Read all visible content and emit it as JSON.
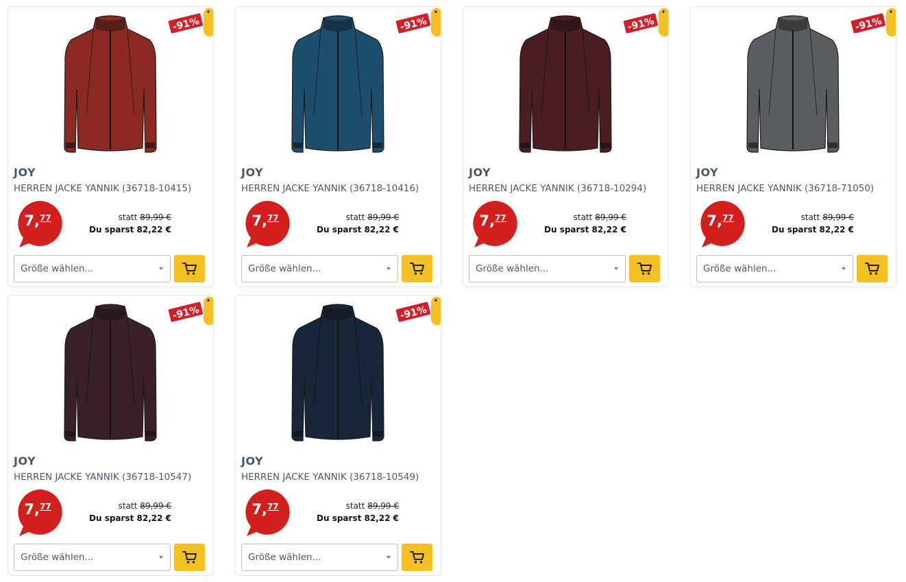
{
  "colors": {
    "accent_yellow": "#f5c023",
    "price_red": "#d41f1f",
    "badge_red": "#d31f2a",
    "border": "#e3e3e3",
    "text_muted": "#4e5866"
  },
  "products": [
    {
      "brand": "JOY",
      "name": "HERREN JACKE YANNIK (36718-10415)",
      "discount": "-91%",
      "price_int": "7,",
      "price_dec": "77",
      "statt_label": "statt",
      "old_price": "89,99 €",
      "savings": "Du sparst 82,22 €",
      "size_placeholder": "Größe wählen...",
      "jacket_color": "#8b2a22",
      "icons": [
        "price-bubble-icon",
        "chevron-down-icon",
        "cart-icon"
      ]
    },
    {
      "brand": "JOY",
      "name": "HERREN JACKE YANNIK (36718-10416)",
      "discount": "-91%",
      "price_int": "7,",
      "price_dec": "77",
      "statt_label": "statt",
      "old_price": "89,99 €",
      "savings": "Du sparst 82,22 €",
      "size_placeholder": "Größe wählen...",
      "jacket_color": "#1d4e6e",
      "icons": [
        "price-bubble-icon",
        "chevron-down-icon",
        "cart-icon"
      ]
    },
    {
      "brand": "JOY",
      "name": "HERREN JACKE YANNIK (36718-10294)",
      "discount": "-91%",
      "price_int": "7,",
      "price_dec": "77",
      "statt_label": "statt",
      "old_price": "89,99 €",
      "savings": "Du sparst 82,22 €",
      "size_placeholder": "Größe wählen...",
      "jacket_color": "#4a1d22",
      "icons": [
        "price-bubble-icon",
        "chevron-down-icon",
        "cart-icon"
      ]
    },
    {
      "brand": "JOY",
      "name": "HERREN JACKE YANNIK (36718-71050)",
      "discount": "-91%",
      "price_int": "7,",
      "price_dec": "77",
      "statt_label": "statt",
      "old_price": "89,99 €",
      "savings": "Du sparst 82,22 €",
      "size_placeholder": "Größe wählen...",
      "jacket_color": "#5a5d62",
      "icons": [
        "price-bubble-icon",
        "chevron-down-icon",
        "cart-icon"
      ]
    },
    {
      "brand": "JOY",
      "name": "HERREN JACKE YANNIK (36718-10547)",
      "discount": "-91%",
      "price_int": "7,",
      "price_dec": "77",
      "statt_label": "statt",
      "old_price": "89,99 €",
      "savings": "Du sparst 82,22 €",
      "size_placeholder": "Größe wählen...",
      "jacket_color": "#3a2028",
      "icons": [
        "price-bubble-icon",
        "chevron-down-icon",
        "cart-icon"
      ]
    },
    {
      "brand": "JOY",
      "name": "HERREN JACKE YANNIK (36718-10549)",
      "discount": "-91%",
      "price_int": "7,",
      "price_dec": "77",
      "statt_label": "statt",
      "old_price": "89,99 €",
      "savings": "Du sparst 82,22 €",
      "size_placeholder": "Größe wählen...",
      "jacket_color": "#18263a",
      "icons": [
        "price-bubble-icon",
        "chevron-down-icon",
        "cart-icon"
      ]
    }
  ]
}
